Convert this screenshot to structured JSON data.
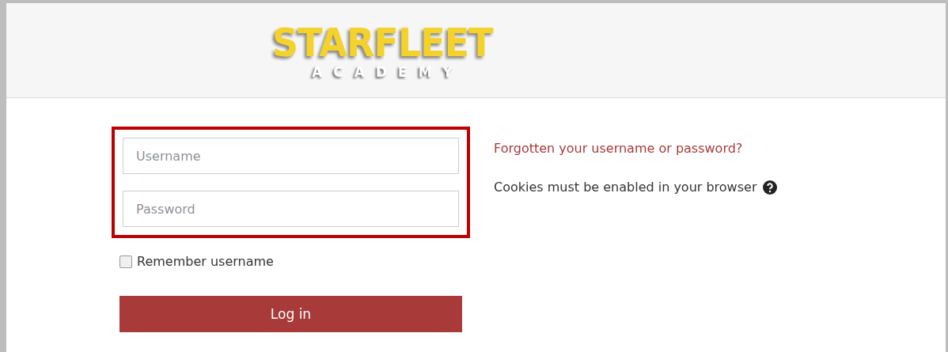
{
  "header": {
    "logo": {
      "title": "STARFLEET",
      "subtitle": "ACADEMY"
    }
  },
  "login": {
    "credentials_highlighted": true,
    "fields": [
      {
        "placeholder": "Username"
      },
      {
        "placeholder": "Password"
      }
    ],
    "remember": {
      "label": "Remember username",
      "checked": false
    },
    "button": "Log in"
  },
  "help": {
    "forgot_link": "Forgotten your username or password?",
    "cookies_note": "Cookies must be enabled in your browser"
  }
}
